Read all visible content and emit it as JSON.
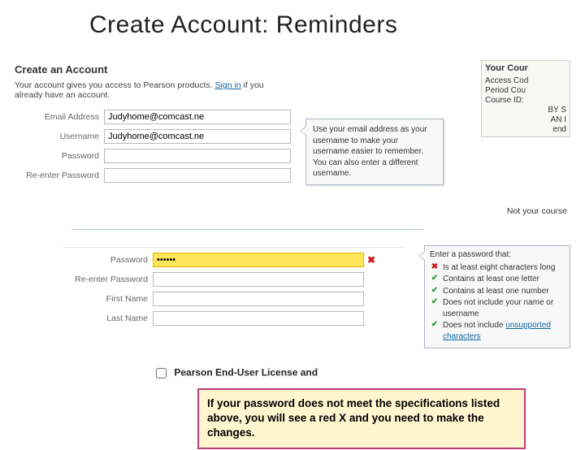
{
  "slide_title": "Create Account: Reminders",
  "section_heading": "Create an Account",
  "intro": {
    "pre": "Your account gives you access to Pearson products. ",
    "link": "Sign in",
    "post": " if you already have an account."
  },
  "top_form": {
    "email_label": "Email Address",
    "email_value": "Judyhome@comcast.ne",
    "username_label": "Username",
    "username_value": "Judyhome@comcast.ne",
    "password_label": "Password",
    "reenter_label": "Re-enter Password"
  },
  "username_tooltip": "Use your email address as your username to make your username easier to remember. You can also enter a different username.",
  "right_panel": {
    "title": "Your Cour",
    "lines": [
      "Access Cod",
      "Period Cou",
      "Course ID:",
      "BY S",
      "AN I",
      "end"
    ]
  },
  "not_your_course": "Not your course",
  "second_form": {
    "password_label": "Password",
    "password_value": "••••••",
    "reenter_label": "Re-enter Password",
    "first_name_label": "First Name",
    "last_name_label": "Last Name"
  },
  "req_title": "Enter a password that:",
  "reqs": [
    {
      "ok": false,
      "label": "Is at least eight characters long"
    },
    {
      "ok": true,
      "label": "Contains at least one letter"
    },
    {
      "ok": true,
      "label": "Contains at least one number"
    },
    {
      "ok": true,
      "label": "Does not include your name or username"
    },
    {
      "ok": true,
      "label_pre": "Does not include ",
      "link": "unsupported characters"
    }
  ],
  "license_text": "Pearson End-User License and",
  "callout": "If your password does not meet the specifications listed above, you will see a red X and you need to make the changes."
}
